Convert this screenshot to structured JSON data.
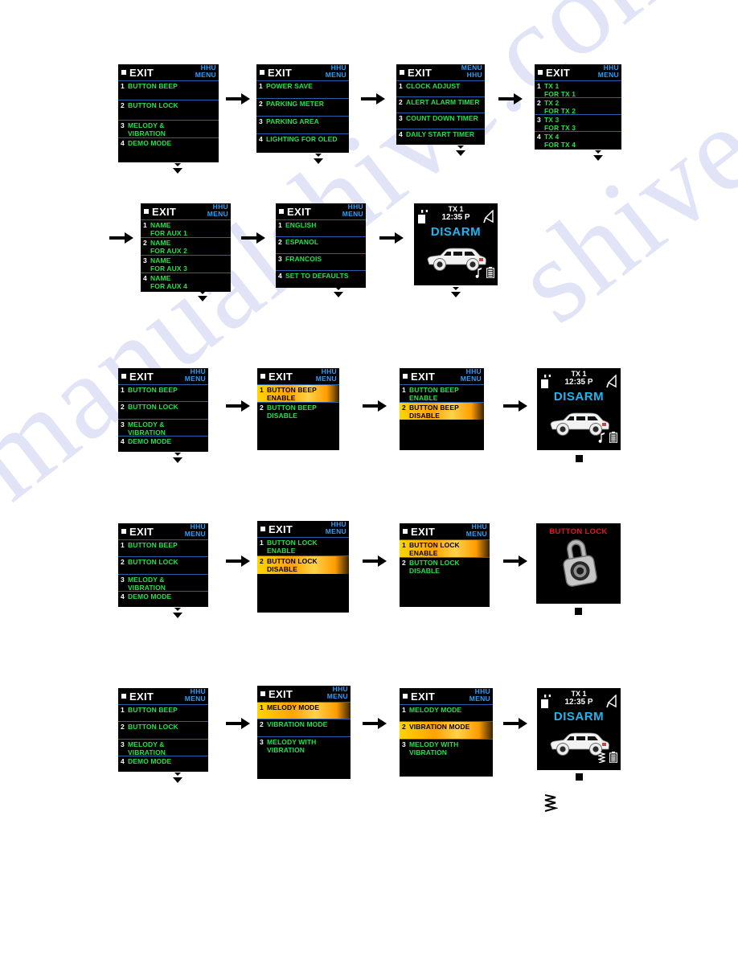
{
  "watermark": {
    "line1": "manualshive.com",
    "line2": "shive.com"
  },
  "colors": {
    "screen_bg": "#000000",
    "menu_item_green": "#25e049",
    "header_blue": "#2f9ef7",
    "separator_blue": "#2a5fa8",
    "highlight_orange": "#ffa300",
    "disarm_cyan": "#1fb6ef",
    "alert_red": "#e01b1b",
    "white": "#ffffff"
  },
  "header": {
    "exit_label": "EXIT",
    "hhu": "HHU",
    "menu": "MENU"
  },
  "rows": [
    {
      "id": "row-main-menu-navigation",
      "screens": [
        {
          "type": "menu",
          "name": "main-menu",
          "head": {
            "exit": "EXIT",
            "top": "HHU",
            "bottom": "MENU"
          },
          "items": [
            {
              "num": "1",
              "l1": "BUTTON BEEP",
              "l2": "",
              "selected": false
            },
            {
              "num": "2",
              "l1": "BUTTON LOCK",
              "l2": "",
              "selected": false
            },
            {
              "num": "3",
              "l1": "MELODY &",
              "l2": "VIBRATION",
              "selected": false
            },
            {
              "num": "4",
              "l1": "DEMO MODE",
              "l2": "",
              "selected": false
            }
          ]
        },
        {
          "type": "menu",
          "name": "power-parking-menu",
          "head": {
            "exit": "EXIT",
            "top": "HHU",
            "bottom": "MENU"
          },
          "items": [
            {
              "num": "1",
              "l1": "POWER SAVE",
              "l2": "",
              "selected": false
            },
            {
              "num": "2",
              "l1": "PARKING METER",
              "l2": "",
              "selected": false
            },
            {
              "num": "3",
              "l1": "PARKING AREA",
              "l2": "",
              "selected": false
            },
            {
              "num": "4",
              "l1": "LIGHTING FOR OLED",
              "l2": "",
              "selected": false
            }
          ]
        },
        {
          "type": "menu",
          "name": "timer-menu",
          "head": {
            "exit": "EXIT",
            "top": "MENU",
            "bottom": "HHU"
          },
          "items": [
            {
              "num": "1",
              "l1": "CLOCK ADJUST",
              "l2": "",
              "selected": false
            },
            {
              "num": "2",
              "l1": "ALERT ALARM TIMER",
              "l2": "",
              "selected": false
            },
            {
              "num": "3",
              "l1": "COUNT DOWN TIMER",
              "l2": "",
              "selected": false
            },
            {
              "num": "4",
              "l1": "DAILY START TIMER",
              "l2": "",
              "selected": false
            }
          ]
        },
        {
          "type": "menu",
          "name": "tx-menu",
          "head": {
            "exit": "EXIT",
            "top": "HHU",
            "bottom": "MENU"
          },
          "items": [
            {
              "num": "1",
              "l1": "TX 1",
              "l2": "FOR TX 1",
              "selected": false
            },
            {
              "num": "2",
              "l1": "TX 2",
              "l2": "FOR TX 2",
              "selected": false
            },
            {
              "num": "3",
              "l1": "TX 3",
              "l2": "FOR TX 3",
              "selected": false
            },
            {
              "num": "4",
              "l1": "TX 4",
              "l2": "FOR TX 4",
              "selected": false
            }
          ]
        }
      ]
    },
    {
      "id": "row-aux-language",
      "screens": [
        {
          "type": "menu",
          "name": "aux-name-menu",
          "head": {
            "exit": "EXIT",
            "top": "HHU",
            "bottom": "MENU"
          },
          "items": [
            {
              "num": "1",
              "l1": "NAME",
              "l2": "FOR AUX 1",
              "selected": false
            },
            {
              "num": "2",
              "l1": "NAME",
              "l2": "FOR AUX 2",
              "selected": false
            },
            {
              "num": "3",
              "l1": "NAME",
              "l2": "FOR AUX 3",
              "selected": false
            },
            {
              "num": "4",
              "l1": "NAME",
              "l2": "FOR AUX 4",
              "selected": false
            }
          ]
        },
        {
          "type": "menu",
          "name": "language-menu",
          "head": {
            "exit": "EXIT",
            "top": "HHU",
            "bottom": "MENU"
          },
          "items": [
            {
              "num": "1",
              "l1": "ENGLISH",
              "l2": "",
              "selected": false
            },
            {
              "num": "2",
              "l1": "ESPANOL",
              "l2": "",
              "selected": false
            },
            {
              "num": "3",
              "l1": "FRANCOIS",
              "l2": "",
              "selected": false
            },
            {
              "num": "4",
              "l1": "SET TO DEFAULTS",
              "l2": "",
              "selected": false
            }
          ]
        },
        {
          "type": "disarm",
          "name": "disarm-status-screen",
          "tx": "TX 1",
          "time": "12:35 P",
          "state": "DISARM",
          "icons": [
            "unlock-icon",
            "antenna-icon",
            "music-note-icon",
            "battery-icon",
            "vehicle-icon"
          ]
        }
      ]
    },
    {
      "id": "row-button-beep",
      "screens": [
        {
          "type": "menu",
          "name": "main-menu",
          "head": {
            "exit": "EXIT",
            "top": "HHU",
            "bottom": "MENU"
          },
          "items": [
            {
              "num": "1",
              "l1": "BUTTON BEEP",
              "l2": "",
              "selected": false
            },
            {
              "num": "2",
              "l1": "BUTTON LOCK",
              "l2": "",
              "selected": false
            },
            {
              "num": "3",
              "l1": "MELODY &",
              "l2": "VIBRATION",
              "selected": false
            },
            {
              "num": "4",
              "l1": "DEMO MODE",
              "l2": "",
              "selected": false
            }
          ]
        },
        {
          "type": "menu",
          "name": "button-beep-menu-enable-selected",
          "head": {
            "exit": "EXIT",
            "top": "HHU",
            "bottom": "MENU"
          },
          "items": [
            {
              "num": "1",
              "l1": "BUTTON BEEP",
              "l2": "ENABLE",
              "selected": true
            },
            {
              "num": "2",
              "l1": "BUTTON BEEP",
              "l2": "DISABLE",
              "selected": false
            }
          ]
        },
        {
          "type": "menu",
          "name": "button-beep-menu-disable-selected",
          "head": {
            "exit": "EXIT",
            "top": "HHU",
            "bottom": "MENU"
          },
          "items": [
            {
              "num": "1",
              "l1": "BUTTON BEEP",
              "l2": "ENABLE",
              "selected": false
            },
            {
              "num": "2",
              "l1": "BUTTON BEEP",
              "l2": "DISABLE",
              "selected": true
            }
          ]
        },
        {
          "type": "disarm",
          "name": "disarm-status-screen",
          "tx": "TX 1",
          "time": "12:35 P",
          "state": "DISARM",
          "icons": [
            "unlock-icon",
            "antenna-icon",
            "music-note-icon",
            "battery-icon",
            "vehicle-icon"
          ]
        }
      ]
    },
    {
      "id": "row-button-lock",
      "screens": [
        {
          "type": "menu",
          "name": "main-menu",
          "head": {
            "exit": "EXIT",
            "top": "HHU",
            "bottom": "MENU"
          },
          "items": [
            {
              "num": "1",
              "l1": "BUTTON BEEP",
              "l2": "",
              "selected": false
            },
            {
              "num": "2",
              "l1": "BUTTON LOCK",
              "l2": "",
              "selected": false
            },
            {
              "num": "3",
              "l1": "MELODY &",
              "l2": "VIBRATION",
              "selected": false
            },
            {
              "num": "4",
              "l1": "DEMO MODE",
              "l2": "",
              "selected": false
            }
          ]
        },
        {
          "type": "menu",
          "name": "button-lock-menu-disable-selected",
          "head": {
            "exit": "EXIT",
            "top": "HHU",
            "bottom": "MENU"
          },
          "items": [
            {
              "num": "1",
              "l1": "BUTTON LOCK",
              "l2": "ENABLE",
              "selected": false
            },
            {
              "num": "2",
              "l1": "BUTTON LOCK",
              "l2": "DISABLE",
              "selected": true
            }
          ]
        },
        {
          "type": "menu",
          "name": "button-lock-menu-enable-selected",
          "head": {
            "exit": "EXIT",
            "top": "HHU",
            "bottom": "MENU"
          },
          "items": [
            {
              "num": "1",
              "l1": "BUTTON LOCK",
              "l2": "ENABLE",
              "selected": true
            },
            {
              "num": "2",
              "l1": "BUTTON LOCK",
              "l2": "DISABLE",
              "selected": false
            }
          ]
        },
        {
          "type": "lockalert",
          "name": "button-lock-alert-screen",
          "title": "BUTTON LOCK",
          "icons": [
            "padlock-icon"
          ]
        }
      ]
    },
    {
      "id": "row-melody-vibration",
      "screens": [
        {
          "type": "menu",
          "name": "main-menu",
          "head": {
            "exit": "EXIT",
            "top": "HHU",
            "bottom": "MENU"
          },
          "items": [
            {
              "num": "1",
              "l1": "BUTTON BEEP",
              "l2": "",
              "selected": false
            },
            {
              "num": "2",
              "l1": "BUTTON LOCK",
              "l2": "",
              "selected": false
            },
            {
              "num": "3",
              "l1": "MELODY &",
              "l2": "VIBRATION",
              "selected": false
            },
            {
              "num": "4",
              "l1": "DEMO MODE",
              "l2": "",
              "selected": false
            }
          ]
        },
        {
          "type": "menu",
          "name": "melody-menu-melody-selected",
          "head": {
            "exit": "EXIT",
            "top": "HHU",
            "bottom": "MENU"
          },
          "items": [
            {
              "num": "1",
              "l1": "MELODY MODE",
              "l2": "",
              "selected": true
            },
            {
              "num": "2",
              "l1": "VIBRATION MODE",
              "l2": "",
              "selected": false
            },
            {
              "num": "3",
              "l1": "MELODY WITH",
              "l2": "VIBRATION",
              "selected": false
            }
          ]
        },
        {
          "type": "menu",
          "name": "melody-menu-vibration-selected",
          "head": {
            "exit": "EXIT",
            "top": "HHU",
            "bottom": "MENU"
          },
          "items": [
            {
              "num": "1",
              "l1": "MELODY MODE",
              "l2": "",
              "selected": false
            },
            {
              "num": "2",
              "l1": "VIBRATION MODE",
              "l2": "",
              "selected": true
            },
            {
              "num": "3",
              "l1": "MELODY WITH",
              "l2": "VIBRATION",
              "selected": false
            }
          ]
        },
        {
          "type": "disarm",
          "name": "disarm-status-screen-vibration",
          "tx": "TX 1",
          "time": "12:35 P",
          "state": "DISARM",
          "icons": [
            "unlock-icon",
            "antenna-icon",
            "vibration-icon",
            "battery-icon",
            "vehicle-icon"
          ]
        }
      ]
    }
  ]
}
